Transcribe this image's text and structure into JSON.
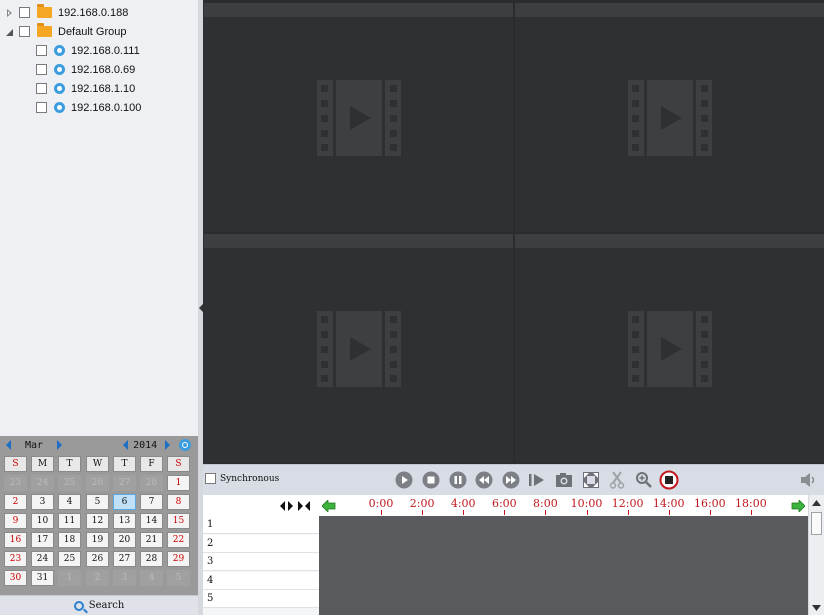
{
  "tree": {
    "nodes": [
      {
        "label": "192.168.0.188",
        "kind": "folder",
        "state": "collapsed"
      },
      {
        "label": "Default Group",
        "kind": "folder",
        "state": "expanded"
      },
      {
        "label": "192.168.0.111",
        "kind": "camera"
      },
      {
        "label": "192.168.0.69",
        "kind": "camera"
      },
      {
        "label": "192.168.1.10",
        "kind": "camera"
      },
      {
        "label": "192.168.0.100",
        "kind": "camera"
      }
    ]
  },
  "calendar": {
    "month": "Mar",
    "year": "2014",
    "weekdays": [
      "S",
      "M",
      "T",
      "W",
      "T",
      "F",
      "S"
    ],
    "weeks": [
      [
        "23",
        "24",
        "25",
        "26",
        "27",
        "28",
        "1"
      ],
      [
        "2",
        "3",
        "4",
        "5",
        "6",
        "7",
        "8"
      ],
      [
        "9",
        "10",
        "11",
        "12",
        "13",
        "14",
        "15"
      ],
      [
        "16",
        "17",
        "18",
        "19",
        "20",
        "21",
        "22"
      ],
      [
        "23",
        "24",
        "25",
        "26",
        "27",
        "28",
        "29"
      ],
      [
        "30",
        "31",
        "1",
        "2",
        "3",
        "4",
        "5"
      ]
    ],
    "selected_day": "6",
    "search_label": "Search"
  },
  "controls": {
    "sync_label": "Synchronous",
    "buttons": [
      "play-icon",
      "stop-icon",
      "pause-icon",
      "rewind-icon",
      "fast-forward-icon",
      "step-frame-icon",
      "snapshot-icon",
      "fullscreen-icon",
      "clip-icon",
      "zoom-icon",
      "record-stop-icon",
      "volume-icon"
    ]
  },
  "timeline": {
    "ticks": [
      "0:00",
      "2:00",
      "4:00",
      "6:00",
      "8:00",
      "10:00",
      "12:00",
      "14:00",
      "16:00",
      "18:00"
    ],
    "channels": [
      "1",
      "2",
      "3",
      "4",
      "5"
    ]
  },
  "colors": {
    "timeline_tick": "#c0181e",
    "accent_blue": "#2a7fd0",
    "record_red": "#c0181e",
    "video_bg": "#2f3034"
  }
}
